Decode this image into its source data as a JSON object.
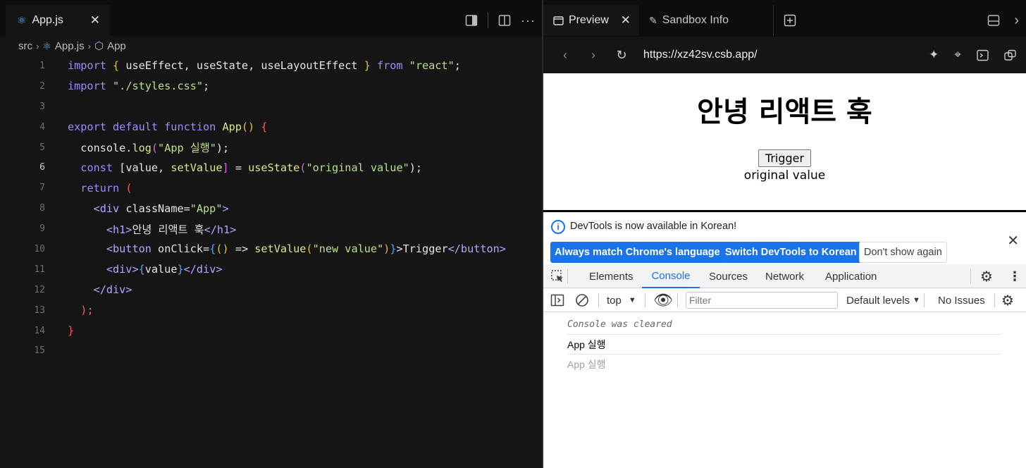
{
  "editor": {
    "tab_label": "App.js",
    "breadcrumb": [
      "src",
      "App.js",
      "App"
    ],
    "lines": [
      {
        "n": "1"
      },
      {
        "n": "2"
      },
      {
        "n": "3"
      },
      {
        "n": "4"
      },
      {
        "n": "5"
      },
      {
        "n": "6"
      },
      {
        "n": "7"
      },
      {
        "n": "8"
      },
      {
        "n": "9"
      },
      {
        "n": "10"
      },
      {
        "n": "11"
      },
      {
        "n": "12"
      },
      {
        "n": "13"
      },
      {
        "n": "14"
      },
      {
        "n": "15"
      }
    ],
    "code": {
      "l1": [
        "import",
        "{",
        "useEffect, useState, useLayoutEffect",
        "}",
        "from",
        "\"react\"",
        ";"
      ],
      "l2": [
        "import",
        "\"./styles.css\"",
        ";"
      ],
      "l4": [
        "export default function",
        "App",
        "()",
        "{"
      ],
      "l5": [
        "console.",
        "log",
        "(",
        "\"App 실행\"",
        ");"
      ],
      "l6": [
        "const",
        "[value,",
        "setValue",
        "]",
        "=",
        "useState",
        "(",
        "\"original value\"",
        ");"
      ],
      "l7": [
        "return",
        "("
      ],
      "l8": [
        "<div",
        "className=",
        "\"App\"",
        ">"
      ],
      "l9": [
        "<h1>",
        "안녕 리액트 훅",
        "</h1>"
      ],
      "l10": [
        "<button",
        "onClick=",
        "{",
        "()",
        "=>",
        "setValue",
        "(",
        "\"new value\"",
        ")",
        "}",
        ">Trigger",
        "</button>"
      ],
      "l11": [
        "<div>",
        "{",
        "value",
        "}",
        "</div>"
      ],
      "l12": [
        "</div>"
      ],
      "l13": [
        ");"
      ],
      "l14": [
        "}"
      ]
    }
  },
  "preview": {
    "tab_preview": "Preview",
    "tab_info": "Sandbox Info",
    "url": "https://xz42sv.csb.app/",
    "app": {
      "heading": "안녕 리액트 훅",
      "button": "Trigger",
      "value": "original value"
    },
    "devtools": {
      "notice": "DevTools is now available in Korean!",
      "btn_match": "Always match Chrome's language",
      "btn_switch": "Switch DevTools to Korean",
      "btn_dont": "Don't show again",
      "tabs": [
        "Elements",
        "Console",
        "Sources",
        "Network",
        "Application"
      ],
      "context": "top",
      "filter_placeholder": "Filter",
      "levels": "Default levels",
      "issues": "No Issues",
      "logs": [
        "Console was cleared",
        "App 실행",
        "App 실행"
      ]
    }
  },
  "colors": {
    "keyword": "#9b8cff",
    "string": "#b9e08b",
    "accent": "#1a73e8"
  }
}
